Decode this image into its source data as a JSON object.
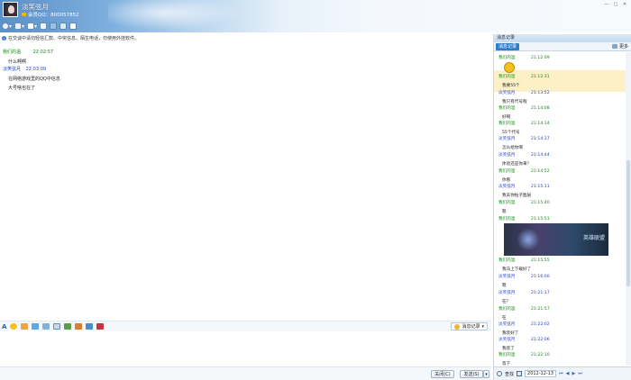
{
  "header": {
    "name": "淡笑弦月",
    "qq_line": "会员QQ：800057852",
    "toolbar_icons": [
      "video-icon",
      "mic-icon",
      "share-icon",
      "mail-icon",
      "group-icon",
      "app-icon",
      "file-icon"
    ]
  },
  "notice": "在交谈中请勿轻信汇款、中奖信息、陌生电话，勿使用外挂软件。",
  "chat": {
    "messages": [
      {
        "sender": "我们的温",
        "time": "22:02:57",
        "role": "me",
        "lines": [
          "什么啊啊"
        ]
      },
      {
        "sender": "淡笑弦月",
        "time": "22:03:09",
        "role": "other",
        "lines": [
          "在网络游戏里的QQ中信息",
          "大号啥也在了"
        ]
      }
    ]
  },
  "input_toolbar": {
    "history_label": "消息记录"
  },
  "bottom": {
    "close_label": "关闭(C)",
    "send_label": "发送(S)"
  },
  "history": {
    "title": "消息记录",
    "tab_label": "消息记录",
    "more_label": "更多",
    "items": [
      {
        "sender": "我们的温",
        "time": "21:12:09",
        "role": "me",
        "text": "",
        "sticker": true
      },
      {
        "sender": "我们的温",
        "time": "21:12:31",
        "role": "me",
        "text": "我要55个"
      },
      {
        "sender": "淡笑弦月",
        "time": "21:13:52",
        "role": "other",
        "text": "我只有代号啦"
      },
      {
        "sender": "我们的温",
        "time": "21:14:08",
        "role": "me",
        "text": "好啊"
      },
      {
        "sender": "我们的温",
        "time": "21:14:14",
        "role": "me",
        "text": "55个代号"
      },
      {
        "sender": "淡笑弦月",
        "time": "21:14:37",
        "role": "other",
        "text": "怎么给你啊"
      },
      {
        "sender": "淡笑弦月",
        "time": "21:14:44",
        "role": "other",
        "text": "体验还是你来？"
      },
      {
        "sender": "我们的温",
        "time": "21:14:52",
        "role": "me",
        "text": "你看"
      },
      {
        "sender": "淡笑弦月",
        "time": "21:15:11",
        "role": "other",
        "text": "我去你帖子图层"
      },
      {
        "sender": "我们的温",
        "time": "21:15:40",
        "role": "me",
        "text": "嗯"
      },
      {
        "sender": "我们的温",
        "time": "21:15:51",
        "role": "me",
        "text": "",
        "banner": "英雄联盟"
      },
      {
        "sender": "我们的温",
        "time": "21:15:55",
        "role": "me",
        "text": "我马上下载好了"
      },
      {
        "sender": "淡笑弦月",
        "time": "21:16:00",
        "role": "other",
        "text": "嗯"
      },
      {
        "sender": "淡笑弦月",
        "time": "21:21:17",
        "role": "other",
        "text": "在？"
      },
      {
        "sender": "我们的温",
        "time": "21:21:57",
        "role": "me",
        "text": "在"
      },
      {
        "sender": "淡笑弦月",
        "time": "21:22:02",
        "role": "other",
        "text": "我装好了"
      },
      {
        "sender": "淡笑弦月",
        "time": "21:22:06",
        "role": "other",
        "text": "我装了"
      },
      {
        "sender": "我们的温",
        "time": "21:22:10",
        "role": "me",
        "text": "等下"
      }
    ],
    "footer": {
      "search_label": "查找",
      "date": "2012-12-13"
    }
  }
}
